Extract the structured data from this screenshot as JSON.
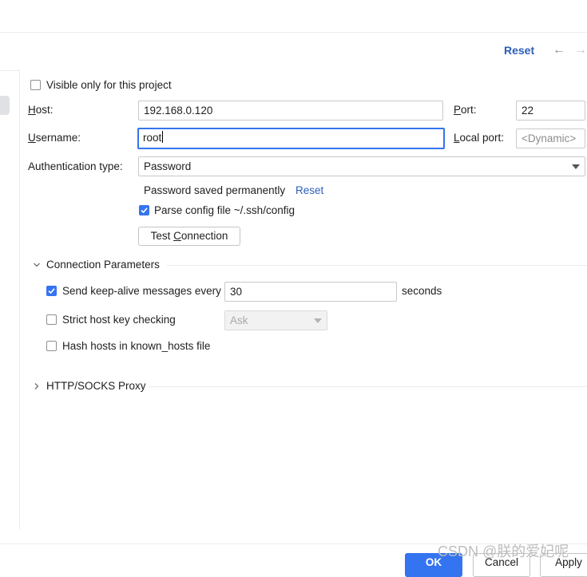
{
  "header": {
    "reset_label": "Reset",
    "back_icon": "arrow-left-icon",
    "forward_icon": "arrow-right-icon"
  },
  "visible_only": {
    "label": "Visible only for this project",
    "checked": false
  },
  "host": {
    "label": "Host:",
    "value": "192.168.0.120"
  },
  "port": {
    "label": "Port:",
    "value": "22"
  },
  "username": {
    "label": "Username:",
    "value": "root"
  },
  "local_port": {
    "label": "Local port:",
    "placeholder": "<Dynamic>"
  },
  "auth": {
    "label": "Authentication type:",
    "value": "Password"
  },
  "password_saved": {
    "text": "Password saved permanently",
    "reset_label": "Reset"
  },
  "parse_config": {
    "label": "Parse config file ~/.ssh/config",
    "checked": true
  },
  "test_connection": {
    "label": "Test Connection"
  },
  "connection_params": {
    "title": "Connection Parameters",
    "keep_alive": {
      "label": "Send keep-alive messages every",
      "value": "30",
      "unit": "seconds",
      "checked": true
    },
    "strict_host": {
      "label": "Strict host key checking",
      "value": "Ask",
      "checked": false
    },
    "hash_hosts": {
      "label": "Hash hosts in known_hosts file",
      "checked": false
    }
  },
  "proxy": {
    "title": "HTTP/SOCKS Proxy"
  },
  "footer": {
    "ok_label": "OK",
    "cancel_label": "Cancel",
    "apply_label": "Apply"
  },
  "watermark": "CSDN @朕的爱妃呢",
  "colors": {
    "accent": "#3574f0",
    "link": "#2b5eb8"
  }
}
